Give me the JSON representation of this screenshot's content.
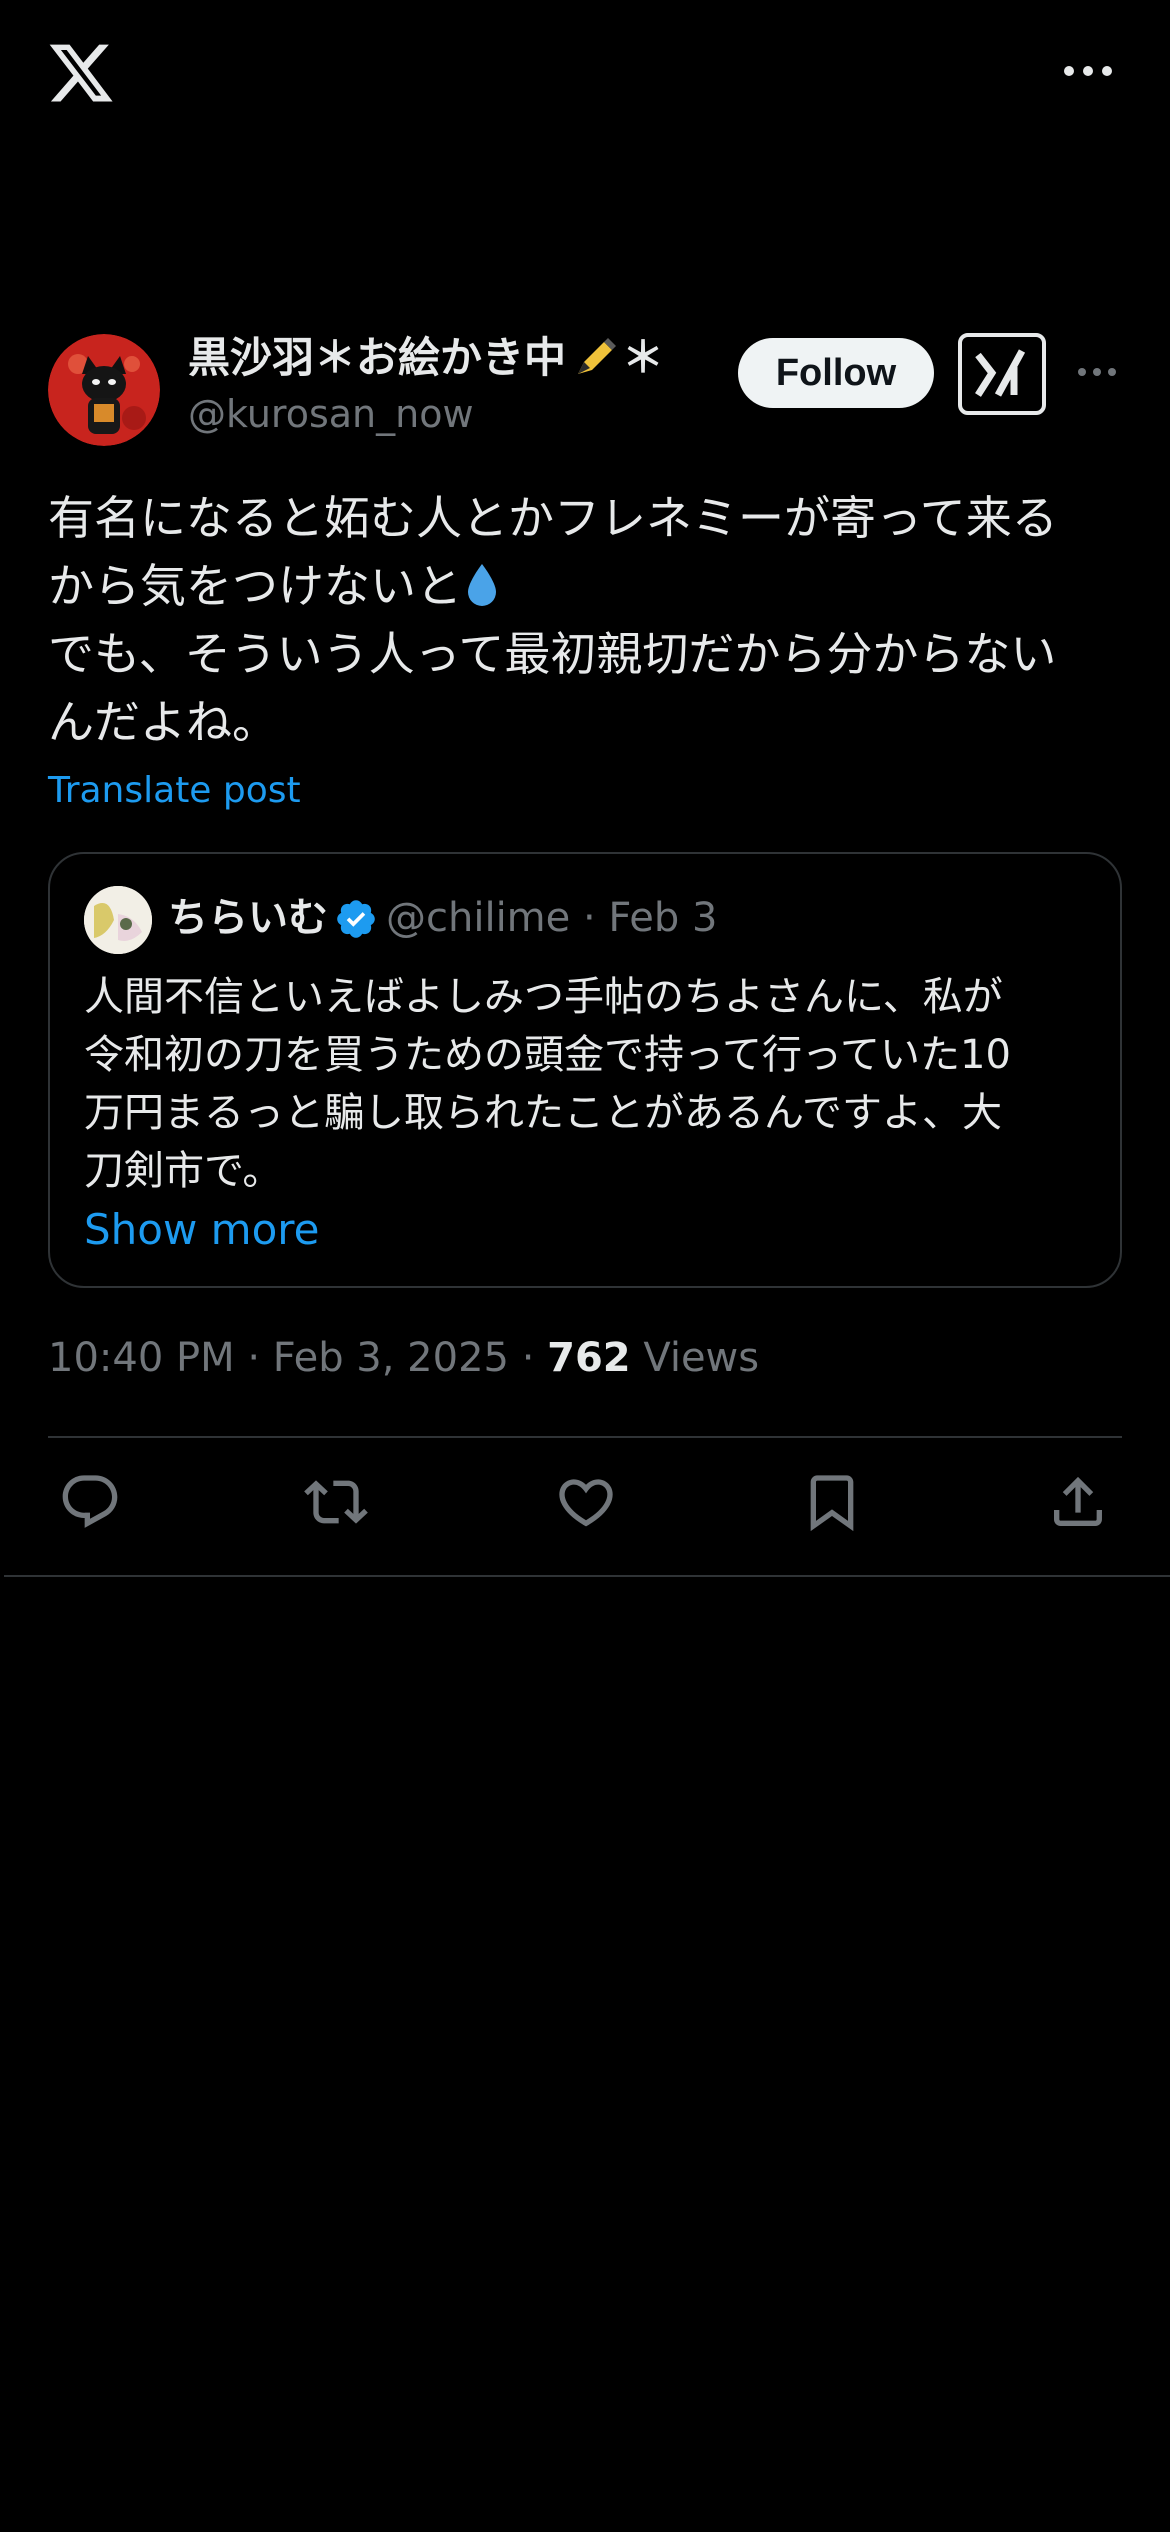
{
  "topbar": {
    "logo_icon": "x-logo-icon",
    "more_icon": "more-horizontal-icon"
  },
  "post": {
    "author": {
      "display_name_part1": "黒沙羽＊お絵かき中",
      "display_name_part2": "＊",
      "handle": "@kurosan_now"
    },
    "follow_label": "Follow",
    "text_line1": "有名になると妬む人とかフレネミーが寄って来る\nから気をつけないと",
    "text_line2": "\nでも、そういう人って最初親切だから分からない\nんだよね。",
    "translate_label": "Translate post",
    "quote": {
      "name": "ちらいむ",
      "handle": "@chilime",
      "separator": " · ",
      "date": "Feb 3",
      "text": "人間不信といえばよしみつ手帖のちよさんに、私が\n令和初の刀を買うための頭金で持って行っていた10\n万円まるっと騙し取られたことがあるんですよ、大\n刀剣市で。",
      "show_more_label": "Show more"
    },
    "timestamp": "10:40 PM · Feb 3, 2025 · ",
    "views_count": "762",
    "views_label": " Views"
  },
  "actions": [
    "reply-icon",
    "repost-icon",
    "like-icon",
    "bookmark-icon",
    "share-icon"
  ],
  "colors": {
    "background": "#000000",
    "text_primary": "#e7e9ea",
    "text_secondary": "#71767b",
    "link_blue": "#1d9bf0",
    "border": "#2f3336",
    "verified_blue": "#1d9bf0"
  }
}
